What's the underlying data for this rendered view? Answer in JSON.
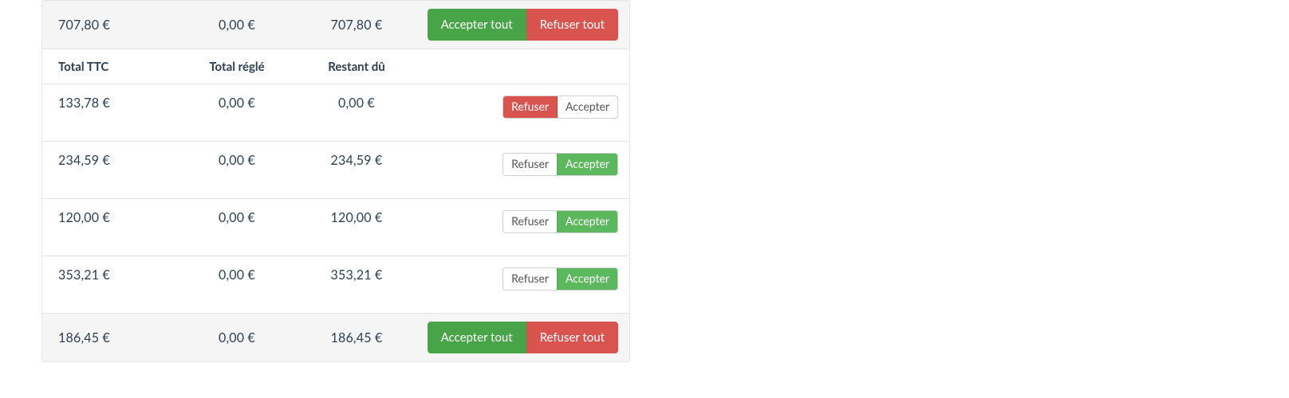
{
  "currency_suffix": " €",
  "headers": {
    "total_ttc": "Total TTC",
    "total_regle": "Total réglé",
    "restant_du": "Restant dû"
  },
  "labels": {
    "accept_all": "Accepter tout",
    "refuse_all": "Refuser tout",
    "accept": "Accepter",
    "refuse": "Refuser"
  },
  "summary_top": {
    "total_ttc": "707,80 €",
    "total_regle": "0,00 €",
    "restant_du": "707,80 €"
  },
  "rows": [
    {
      "total_ttc": "133,78 €",
      "total_regle": "0,00 €",
      "restant_du": "0,00 €",
      "refuse_active": true,
      "accept_active": false
    },
    {
      "total_ttc": "234,59 €",
      "total_regle": "0,00 €",
      "restant_du": "234,59 €",
      "refuse_active": false,
      "accept_active": true
    },
    {
      "total_ttc": "120,00 €",
      "total_regle": "0,00 €",
      "restant_du": "120,00 €",
      "refuse_active": false,
      "accept_active": true
    },
    {
      "total_ttc": "353,21 €",
      "total_regle": "0,00 €",
      "restant_du": "353,21 €",
      "refuse_active": false,
      "accept_active": true
    }
  ],
  "summary_bottom": {
    "total_ttc": "186,45 €",
    "total_regle": "0,00 €",
    "restant_du": "186,45 €"
  }
}
